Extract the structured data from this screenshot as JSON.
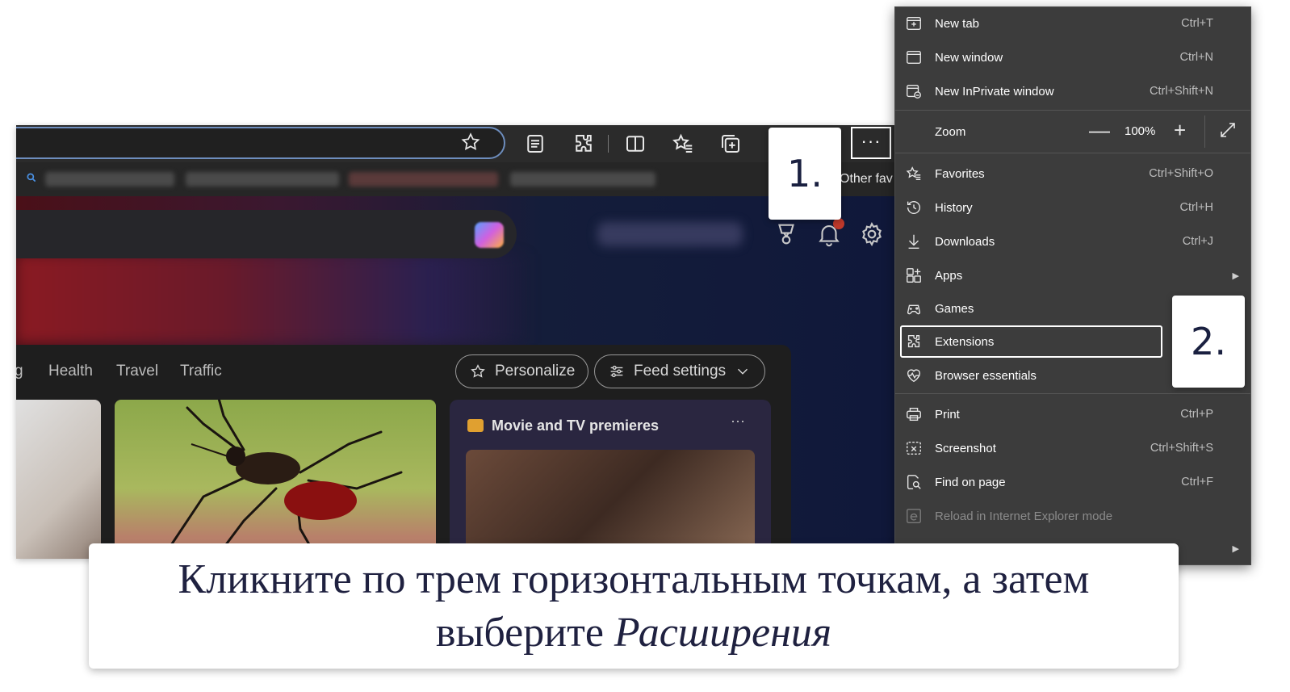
{
  "toolbar": {
    "other_favorites_label": "Other fav",
    "more_button_glyph": "···"
  },
  "feed": {
    "tabs": [
      "g",
      "Health",
      "Travel",
      "Traffic"
    ],
    "personalize_label": "Personalize",
    "feed_settings_label": "Feed settings",
    "movie_card_title": "Movie and TV premieres",
    "movie_card_more": "···"
  },
  "steps": {
    "step1": "1.",
    "step2": "2."
  },
  "menu": {
    "items": [
      {
        "label": "New tab",
        "shortcut": "Ctrl+T",
        "icon": "new-tab-icon"
      },
      {
        "label": "New window",
        "shortcut": "Ctrl+N",
        "icon": "new-window-icon"
      },
      {
        "label": "New InPrivate window",
        "shortcut": "Ctrl+Shift+N",
        "icon": "inprivate-icon"
      },
      {
        "label": "Favorites",
        "shortcut": "Ctrl+Shift+O",
        "icon": "favorites-icon"
      },
      {
        "label": "History",
        "shortcut": "Ctrl+H",
        "icon": "history-icon"
      },
      {
        "label": "Downloads",
        "shortcut": "Ctrl+J",
        "icon": "downloads-icon"
      },
      {
        "label": "Apps",
        "shortcut": "",
        "icon": "apps-icon"
      },
      {
        "label": "Games",
        "shortcut": "",
        "icon": "games-icon"
      },
      {
        "label": "Extensions",
        "shortcut": "",
        "icon": "extensions-icon"
      },
      {
        "label": "Browser essentials",
        "shortcut": "",
        "icon": "browser-essentials-icon"
      },
      {
        "label": "Print",
        "shortcut": "Ctrl+P",
        "icon": "print-icon"
      },
      {
        "label": "Screenshot",
        "shortcut": "Ctrl+Shift+S",
        "icon": "screenshot-icon"
      },
      {
        "label": "Find on page",
        "shortcut": "Ctrl+F",
        "icon": "find-icon"
      },
      {
        "label": "Reload in Internet Explorer mode",
        "shortcut": "",
        "icon": "ie-icon"
      }
    ],
    "zoom": {
      "label": "Zoom",
      "value": "100%",
      "minus": "—",
      "plus": "+"
    }
  },
  "caption": {
    "line1": "Кликните по трем горизонтальным точкам, а затем",
    "line2_prefix": "выберите ",
    "line2_italic": "Расширения"
  }
}
